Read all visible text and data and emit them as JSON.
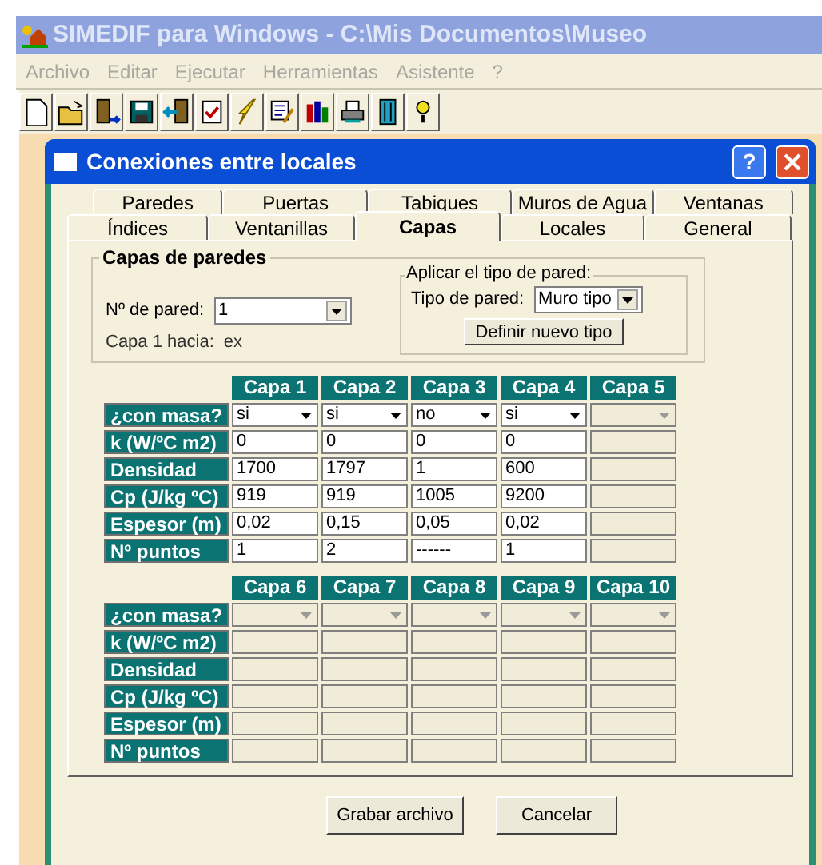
{
  "app": {
    "title": "SIMEDIF para Windows - C:\\Mis Documentos\\Museo"
  },
  "menu": [
    {
      "label": "Archivo",
      "disabled": true
    },
    {
      "label": "Editar",
      "disabled": true
    },
    {
      "label": "Ejecutar",
      "disabled": true
    },
    {
      "label": "Herramientas",
      "disabled": true
    },
    {
      "label": "Asistente",
      "disabled": true
    },
    {
      "label": "?",
      "disabled": true
    }
  ],
  "dialog": {
    "title": "Conexiones entre locales",
    "help_button": "?",
    "tab_rows": [
      [
        {
          "label": "Paredes",
          "selected": false
        },
        {
          "label": "Puertas",
          "selected": false
        },
        {
          "label": "Tabiques",
          "selected": false
        },
        {
          "label": "Muros de Agua",
          "selected": false
        },
        {
          "label": "Ventanas",
          "selected": false
        }
      ],
      [
        {
          "label": "Índices",
          "selected": false
        },
        {
          "label": "Ventanillas",
          "selected": false
        },
        {
          "label": "Capas",
          "selected": true
        },
        {
          "label": "Locales",
          "selected": false
        },
        {
          "label": "General",
          "selected": false
        }
      ]
    ],
    "group": {
      "title": "Capas de paredes",
      "wall_label": "Nº de pared:",
      "wall_value": "1",
      "side_label": "Capa 1 hacia:",
      "side_value": "ex",
      "type_group": {
        "title": "Aplicar el tipo de pared:",
        "label": "Tipo de pared:",
        "value": "Muro tipo",
        "button": "Definir nuevo tipo"
      }
    },
    "tables": [
      {
        "columns": [
          {
            "label": "Capa 1",
            "enabled": true
          },
          {
            "label": "Capa 2",
            "enabled": true
          },
          {
            "label": "Capa 3",
            "enabled": true
          },
          {
            "label": "Capa 4",
            "enabled": true
          },
          {
            "label": "Capa 5",
            "enabled": false
          }
        ],
        "rows": [
          {
            "label": "¿con masa?",
            "kind": "select",
            "cells": [
              "si",
              "si",
              "no",
              "si"
            ]
          },
          {
            "label": "k (W/ºC m2)",
            "kind": "text",
            "cells": [
              "0",
              "0",
              "0",
              "0"
            ]
          },
          {
            "label": "Densidad",
            "kind": "text",
            "cells": [
              "1700",
              "1797",
              "1",
              "600"
            ]
          },
          {
            "label": "Cp (J/kg ºC)",
            "kind": "text",
            "cells": [
              "919",
              "919",
              "1005",
              "9200"
            ]
          },
          {
            "label": "Espesor (m)",
            "kind": "text",
            "cells": [
              "0,02",
              "0,15",
              "0,05",
              "0,02"
            ]
          },
          {
            "label": "Nº puntos",
            "kind": "text",
            "cells": [
              "1",
              "2",
              "------",
              "1"
            ]
          }
        ]
      },
      {
        "columns": [
          {
            "label": "Capa 6",
            "enabled": false
          },
          {
            "label": "Capa 7",
            "enabled": false
          },
          {
            "label": "Capa 8",
            "enabled": false
          },
          {
            "label": "Capa 9",
            "enabled": false
          },
          {
            "label": "Capa 10",
            "enabled": false
          }
        ],
        "rows": [
          {
            "label": "¿con masa?",
            "kind": "select"
          },
          {
            "label": "k (W/ºC m2)",
            "kind": "text"
          },
          {
            "label": "Densidad",
            "kind": "text"
          },
          {
            "label": "Cp (J/kg ºC)",
            "kind": "text"
          },
          {
            "label": "Espesor (m)",
            "kind": "text"
          },
          {
            "label": "Nº puntos",
            "kind": "text"
          }
        ]
      }
    ],
    "buttons": [
      "Grabar archivo",
      "Cancelar"
    ]
  }
}
